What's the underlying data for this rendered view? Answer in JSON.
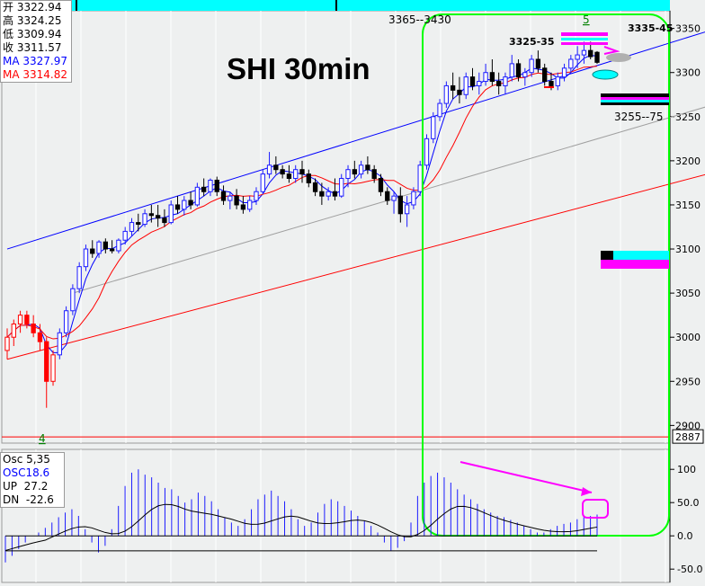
{
  "chart_data": {
    "type": "candlestick",
    "title": "SHI 30min",
    "ohlc_panel": {
      "open_label": "开",
      "open": "3322.94",
      "high_label": "高",
      "high": "3324.25",
      "low_label": "低",
      "low": "3309.94",
      "close_label": "收",
      "close": "3311.57",
      "ma_blue": "MA 3327.97",
      "ma_red": "MA 3314.82"
    },
    "price_axis": {
      "min": 2880,
      "max": 3370,
      "ticks": [
        "3350",
        "3300",
        "3250",
        "3200",
        "3150",
        "3100",
        "3050",
        "3000",
        "2950",
        "2900"
      ],
      "current": "2887"
    },
    "annotations": {
      "range_top": "3365--3430",
      "wave5": "5",
      "wave4": "4",
      "level_3325": "3325-35",
      "level_3335": "3335-45",
      "level_3255": "3255--75"
    },
    "candles": [
      [
        2985,
        3010,
        2975,
        3000
      ],
      [
        3000,
        3020,
        2990,
        3015
      ],
      [
        3015,
        3030,
        3005,
        3025
      ],
      [
        3025,
        3030,
        3010,
        3015
      ],
      [
        3015,
        3025,
        3000,
        3005
      ],
      [
        3005,
        3015,
        2985,
        2995
      ],
      [
        2995,
        3000,
        2920,
        2950
      ],
      [
        2950,
        2985,
        2945,
        2980
      ],
      [
        2980,
        3010,
        2975,
        3005
      ],
      [
        3005,
        3035,
        3000,
        3030
      ],
      [
        3030,
        3060,
        3025,
        3055
      ],
      [
        3055,
        3085,
        3050,
        3080
      ],
      [
        3080,
        3105,
        3075,
        3100
      ],
      [
        3100,
        3110,
        3090,
        3095
      ],
      [
        3095,
        3110,
        3090,
        3108
      ],
      [
        3108,
        3112,
        3095,
        3100
      ],
      [
        3100,
        3110,
        3095,
        3098
      ],
      [
        3098,
        3112,
        3095,
        3110
      ],
      [
        3110,
        3125,
        3105,
        3120
      ],
      [
        3120,
        3135,
        3115,
        3130
      ],
      [
        3130,
        3140,
        3120,
        3128
      ],
      [
        3128,
        3145,
        3125,
        3140
      ],
      [
        3140,
        3150,
        3130,
        3138
      ],
      [
        3138,
        3150,
        3125,
        3135
      ],
      [
        3135,
        3145,
        3125,
        3130
      ],
      [
        3130,
        3155,
        3128,
        3150
      ],
      [
        3150,
        3160,
        3140,
        3145
      ],
      [
        3145,
        3160,
        3138,
        3155
      ],
      [
        3155,
        3165,
        3145,
        3150
      ],
      [
        3150,
        3175,
        3148,
        3170
      ],
      [
        3170,
        3180,
        3160,
        3165
      ],
      [
        3165,
        3180,
        3160,
        3178
      ],
      [
        3178,
        3182,
        3160,
        3165
      ],
      [
        3165,
        3172,
        3150,
        3155
      ],
      [
        3155,
        3165,
        3145,
        3160
      ],
      [
        3160,
        3168,
        3145,
        3150
      ],
      [
        3150,
        3160,
        3140,
        3145
      ],
      [
        3145,
        3160,
        3142,
        3155
      ],
      [
        3155,
        3170,
        3150,
        3165
      ],
      [
        3165,
        3190,
        3162,
        3185
      ],
      [
        3185,
        3210,
        3180,
        3195
      ],
      [
        3195,
        3205,
        3185,
        3190
      ],
      [
        3190,
        3195,
        3180,
        3185
      ],
      [
        3185,
        3195,
        3175,
        3180
      ],
      [
        3180,
        3195,
        3175,
        3190
      ],
      [
        3190,
        3200,
        3175,
        3185
      ],
      [
        3185,
        3190,
        3170,
        3175
      ],
      [
        3175,
        3180,
        3160,
        3165
      ],
      [
        3165,
        3175,
        3150,
        3160
      ],
      [
        3160,
        3170,
        3155,
        3165
      ],
      [
        3165,
        3180,
        3155,
        3160
      ],
      [
        3160,
        3185,
        3158,
        3180
      ],
      [
        3180,
        3195,
        3170,
        3190
      ],
      [
        3190,
        3200,
        3180,
        3185
      ],
      [
        3185,
        3200,
        3180,
        3195
      ],
      [
        3195,
        3205,
        3185,
        3190
      ],
      [
        3190,
        3195,
        3175,
        3180
      ],
      [
        3180,
        3185,
        3160,
        3165
      ],
      [
        3165,
        3170,
        3150,
        3155
      ],
      [
        3155,
        3165,
        3140,
        3160
      ],
      [
        3160,
        3170,
        3130,
        3140
      ],
      [
        3140,
        3160,
        3125,
        3150
      ],
      [
        3150,
        3170,
        3145,
        3165
      ],
      [
        3165,
        3200,
        3160,
        3195
      ],
      [
        3195,
        3230,
        3190,
        3225
      ],
      [
        3225,
        3255,
        3220,
        3250
      ],
      [
        3250,
        3270,
        3245,
        3265
      ],
      [
        3265,
        3290,
        3260,
        3285
      ],
      [
        3285,
        3300,
        3270,
        3280
      ],
      [
        3280,
        3295,
        3265,
        3275
      ],
      [
        3275,
        3300,
        3270,
        3295
      ],
      [
        3295,
        3305,
        3280,
        3285
      ],
      [
        3285,
        3300,
        3275,
        3290
      ],
      [
        3290,
        3310,
        3285,
        3300
      ],
      [
        3300,
        3315,
        3285,
        3290
      ],
      [
        3290,
        3300,
        3275,
        3285
      ],
      [
        3285,
        3300,
        3275,
        3295
      ],
      [
        3295,
        3320,
        3290,
        3310
      ],
      [
        3310,
        3315,
        3290,
        3295
      ],
      [
        3295,
        3305,
        3285,
        3300
      ],
      [
        3300,
        3320,
        3295,
        3315
      ],
      [
        3315,
        3325,
        3300,
        3305
      ],
      [
        3305,
        3310,
        3285,
        3290
      ],
      [
        3290,
        3300,
        3280,
        3285
      ],
      [
        3285,
        3300,
        3280,
        3295
      ],
      [
        3295,
        3310,
        3290,
        3305
      ],
      [
        3305,
        3320,
        3300,
        3315
      ],
      [
        3315,
        3330,
        3305,
        3320
      ],
      [
        3320,
        3335,
        3310,
        3325
      ],
      [
        3325,
        3335,
        3315,
        3318
      ],
      [
        3322.94,
        3324.25,
        3309.94,
        3311.57
      ]
    ],
    "channels": {
      "upper_blue": [
        [
          0,
          3100
        ],
        [
          145,
          3435
        ]
      ],
      "lower_red": [
        [
          0,
          2975
        ],
        [
          145,
          3260
        ]
      ],
      "mid_gray": [
        [
          10,
          3050
        ],
        [
          145,
          3345
        ]
      ]
    },
    "oscillator": {
      "name": "Osc 5,35",
      "ma_label": "OSC18.6",
      "up_label": "UP",
      "up_value": "27.2",
      "dn_label": "DN",
      "dn_value": "-22.6",
      "axis_ticks": [
        "100",
        "50.0",
        "0.0",
        "-50.0"
      ],
      "axis_range": [
        -70,
        130
      ],
      "hist_values": [
        -40,
        -30,
        -20,
        -10,
        0,
        5,
        12,
        20,
        28,
        35,
        40,
        30,
        10,
        -10,
        -25,
        -15,
        10,
        45,
        75,
        95,
        100,
        92,
        88,
        80,
        72,
        70,
        60,
        50,
        55,
        65,
        60,
        52,
        40,
        28,
        20,
        15,
        25,
        40,
        55,
        62,
        68,
        60,
        52,
        40,
        25,
        15,
        20,
        35,
        48,
        55,
        52,
        45,
        38,
        30,
        22,
        15,
        5,
        -10,
        -22,
        -18,
        -8,
        20,
        60,
        80,
        90,
        95,
        88,
        80,
        70,
        62,
        55,
        48,
        40,
        35,
        30,
        28,
        24,
        20,
        15,
        10,
        5,
        5,
        10,
        15,
        18,
        20,
        25,
        28,
        30,
        32
      ]
    },
    "colors": {
      "up_candle": "#1c1cff",
      "down_candle": "#000000",
      "early_candle": "#ff0000",
      "ma_blue": "#0000ff",
      "ma_red": "#ff0000",
      "channel_gray": "#a0a0a0",
      "highlight": "#00ff00",
      "magenta": "#ff00ff",
      "cyan": "#00ffff",
      "top_bar": "#00ffff"
    }
  }
}
